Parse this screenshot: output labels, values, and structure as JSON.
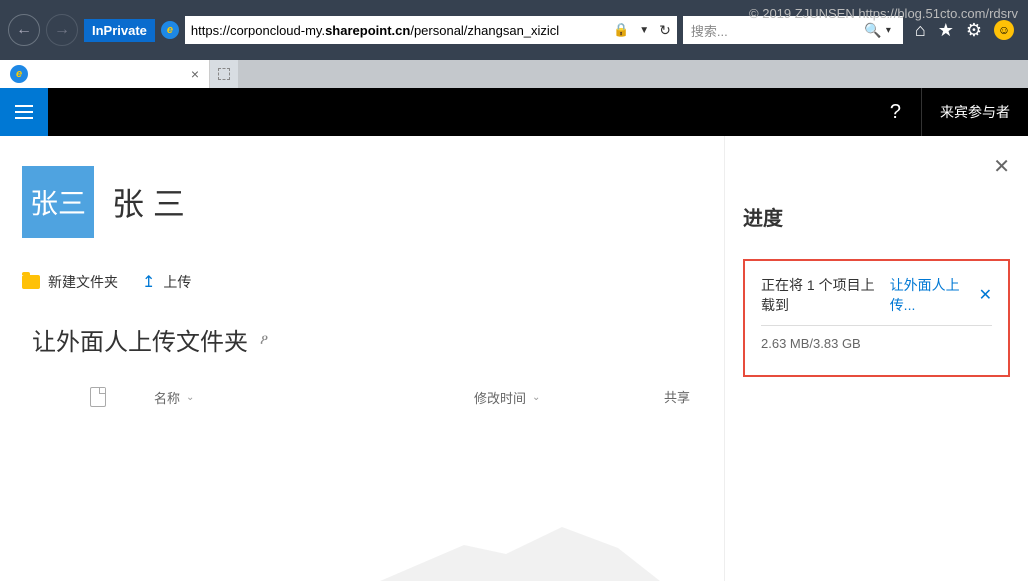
{
  "watermark": "© 2019 ZJUNSEN https://blog.51cto.com/rdsrv",
  "browser": {
    "inprivate_label": "InPrivate",
    "url_prefix": "https://corponcloud-my.",
    "url_bold": "sharepoint.cn",
    "url_suffix": "/personal/zhangsan_xizicl",
    "search_placeholder": "搜索..."
  },
  "app_header": {
    "help": "?",
    "guest_role": "来宾参与者"
  },
  "profile": {
    "avatar_text": "张三",
    "username": "张 三"
  },
  "toolbar": {
    "new_folder": "新建文件夹",
    "upload": "上传"
  },
  "folder": {
    "title": "让外面人上传文件夹"
  },
  "columns": {
    "name": "名称",
    "modified": "修改时间",
    "share": "共享"
  },
  "progress": {
    "panel_title": "进度",
    "uploading_text": "正在将 1 个项目上载到 ",
    "uploading_link": "让外面人上传...",
    "size": "2.63 MB/3.83 GB"
  }
}
